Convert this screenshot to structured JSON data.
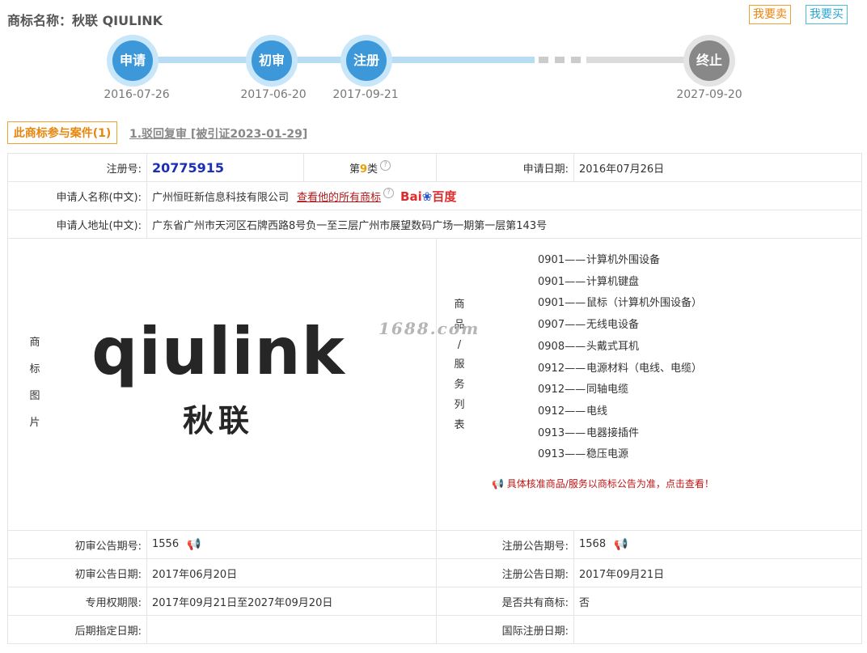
{
  "header": {
    "title": "商标名称：秋联 QIULINK",
    "sell_label": "我要卖",
    "buy_label": "我要买"
  },
  "timeline": {
    "steps": [
      {
        "label": "申请",
        "date": "2016-07-26"
      },
      {
        "label": "初审",
        "date": "2017-06-20"
      },
      {
        "label": "注册",
        "date": "2017-09-21"
      },
      {
        "label": "终止",
        "date": "2027-09-20"
      }
    ],
    "active_color": "#3d98d9",
    "inactive_color": "#888888"
  },
  "cases": {
    "tab_label": "此商标参与案件(1)",
    "case_link": "1.驳回复审 [被引证2023-01-29]"
  },
  "info": {
    "reg_no_label": "注册号:",
    "reg_no": "20775915",
    "class_prefix": "第",
    "class_num": "9",
    "class_suffix": "类",
    "help_icon": "?",
    "apply_date_label": "申请日期:",
    "apply_date": "2016年07月26日",
    "applicant_label": "申请人名称(中文):",
    "applicant": "广州恒旺新信息科技有限公司",
    "view_all_link": "查看他的所有商标",
    "baidu_text_a": "Bai",
    "baidu_paw": "❀",
    "baidu_text_b": "百度",
    "address_label": "申请人地址(中文):",
    "address": "广东省广州市天河区石牌西路8号负一至三层广州市展望数码广场一期第一层第143号",
    "image_label_chars": [
      "商",
      "标",
      "图",
      "片"
    ],
    "logo_word": "qiulink",
    "logo_cn": "秋联",
    "services_label_chars": [
      "商",
      "品",
      "/",
      "服",
      "务",
      "列",
      "表"
    ],
    "services": [
      {
        "code": "0901——",
        "name": "计算机外围设备"
      },
      {
        "code": "0901——",
        "name": "计算机键盘"
      },
      {
        "code": "0901——",
        "name": "鼠标（计算机外围设备）"
      },
      {
        "code": "0907——",
        "name": "无线电设备"
      },
      {
        "code": "0908——",
        "name": "头戴式耳机"
      },
      {
        "code": "0912——",
        "name": "电源材料（电线、电缆）"
      },
      {
        "code": "0912——",
        "name": "同轴电缆"
      },
      {
        "code": "0912——",
        "name": "电线"
      },
      {
        "code": "0913——",
        "name": "电器接插件"
      },
      {
        "code": "0913——",
        "name": "稳压电源"
      }
    ],
    "services_notice": "具体核准商品/服务以商标公告为准，点击查看！",
    "watermark": "1688.com",
    "prelim_no_label": "初审公告期号:",
    "prelim_no": "1556",
    "reg_pub_no_label": "注册公告期号:",
    "reg_pub_no": "1568",
    "prelim_date_label": "初审公告日期:",
    "prelim_date": "2017年06月20日",
    "reg_pub_date_label": "注册公告日期:",
    "reg_pub_date": "2017年09月21日",
    "exclusive_label": "专用权期限:",
    "exclusive_period": "2017年09月21日至2027年09月20日",
    "shared_label": "是否共有商标:",
    "shared": "否",
    "later_date_label": "后期指定日期:",
    "later_date": "",
    "intl_date_label": "国际注册日期:",
    "intl_date": ""
  }
}
